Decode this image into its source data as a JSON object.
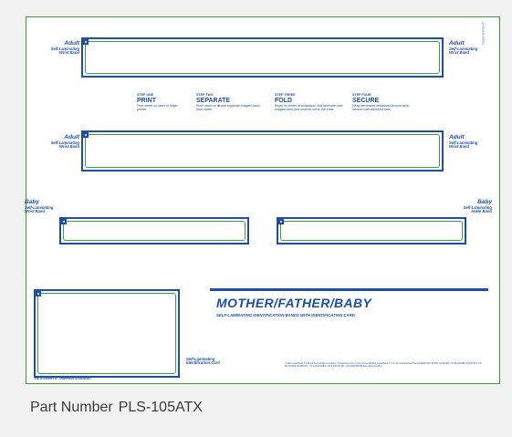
{
  "labels": {
    "adult": "Adult",
    "adult_sub": "Self-Laminating\nWrist Band",
    "baby": "Baby",
    "baby_wrist_sub": "Self-Laminating\nWrist Band",
    "baby_ankle_sub": "Self-Laminating\nAnkle Band",
    "card_sub": "Self-Laminating\nIdentification Card"
  },
  "steps": [
    {
      "num": "STEP ONE",
      "name": "PRINT",
      "desc": "Print sheet on laser or inkjet printer."
    },
    {
      "num": "STEP TWO",
      "name": "SEPARATE",
      "desc": "Push down at ✱ and separate imaged band from sheet."
    },
    {
      "num": "STEP THREE",
      "name": "FOLD",
      "desc": "Begin in center of wristband, fold laminate over imaged area and smooth out to the ends."
    },
    {
      "num": "STEP FOUR",
      "name": "SECURE",
      "desc": "Wrap laminated wristband around wrist. Secure with adhesive tabs."
    }
  ],
  "product": {
    "title": "MOTHER/FATHER/BABY",
    "subtitle": "SELF-LAMINATING IDENTIFICATION BANDS WITH IDENTIFICATION CARD",
    "code": "PLS-105ATX  TAMPER EVIDENT",
    "fine_print": "© 2011 LaserBand ® A Zebra Technologies company. Protected by one or more of the following LaserBand ® U.S. and International Patents RE38,090; 86,602; NL 86,987; US 86,149,086; 86,237,814; US 86,720,829; 86,985,307 ; US 6,925,332B3 ; US 6,945,521 B2 ; US 6,932,860 B2 and others pending.",
    "corner_code": "LB-4010-03  2/2011"
  },
  "footer": {
    "label": "Part Number",
    "value": "PLS-105ATX"
  },
  "colors": {
    "brand_blue": "#1f4ea6",
    "border_green": "#3aa33a"
  }
}
